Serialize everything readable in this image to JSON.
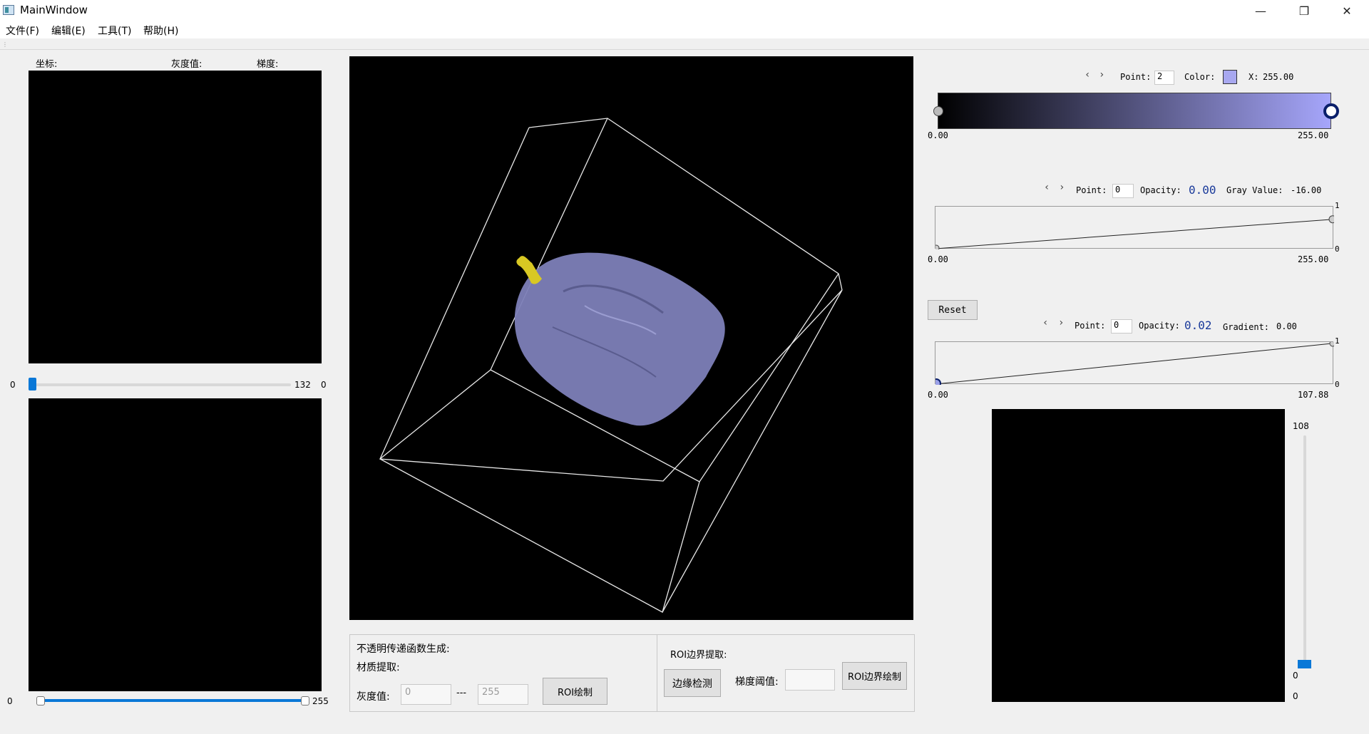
{
  "window": {
    "title": "MainWindow",
    "minimize_glyph": "—",
    "maximize_glyph": "❐",
    "close_glyph": "✕"
  },
  "menu": [
    {
      "label": "文件(F)"
    },
    {
      "label": "编辑(E)"
    },
    {
      "label": "工具(T)"
    },
    {
      "label": "帮助(H)"
    }
  ],
  "left_panel": {
    "coord_label": "坐标:",
    "gray_label": "灰度值:",
    "gradient_label": "梯度:",
    "slice_slider": {
      "min_label": "0",
      "value_label": "132",
      "right_label": "0",
      "value": 132,
      "max": 255
    },
    "range_slider": {
      "min_label": "0",
      "max_label": "255",
      "low": 0,
      "high": 255
    }
  },
  "bottom_center": {
    "opacity_group": {
      "title": "不透明传递函数生成:",
      "material_label": "材质提取:",
      "gray_label": "灰度值:",
      "low_placeholder": "0",
      "separator": "---",
      "high_placeholder": "255",
      "roi_draw_button": "ROI绘制"
    },
    "roi_group": {
      "title": "ROI边界提取:",
      "edge_detect_button": "边缘检测",
      "gradient_threshold_label": "梯度阈值:",
      "gradient_threshold_value": "",
      "roi_boundary_draw_button": "ROI边界绘制"
    }
  },
  "color_tf": {
    "prev_glyph": "‹",
    "next_glyph": "›",
    "point_label": "Point:",
    "point_value": "2",
    "color_label": "Color:",
    "color_swatch": "#a8a8f0",
    "x_label": "X:",
    "x_value": "255.00",
    "min_label": "0.00",
    "max_label": "255.00",
    "gradient_start": "#000000",
    "gradient_end": "#a6a6fb"
  },
  "gray_opacity_tf": {
    "prev_glyph": "‹",
    "next_glyph": "›",
    "point_label": "Point:",
    "point_value": "0",
    "opacity_label": "Opacity:",
    "opacity_value": "0.00",
    "gray_label": "Gray Value:",
    "gray_value": "-16.00",
    "min_label": "0.00",
    "max_label": "255.00",
    "y_top": "1",
    "y_bottom": "0",
    "start_opacity": 0.0,
    "end_opacity": 0.7
  },
  "reset_button": "Reset",
  "gradient_opacity_tf": {
    "prev_glyph": "‹",
    "next_glyph": "›",
    "point_label": "Point:",
    "point_value": "0",
    "opacity_label": "Opacity:",
    "opacity_value": "0.02",
    "gradient_label": "Gradient:",
    "gradient_value": "0.00",
    "min_label": "0.00",
    "max_label": "107.88",
    "y_top": "1",
    "y_bottom": "0",
    "start_opacity": 0.0,
    "end_opacity": 0.97
  },
  "histogram_slider": {
    "top_label": "108",
    "value_label": "0",
    "bottom_label": "0",
    "value": 0,
    "max": 108
  },
  "render": {
    "volume_color": "#7d7fb8",
    "bone_color": "#d8c823",
    "bbox_color": "#e8e8e8"
  }
}
